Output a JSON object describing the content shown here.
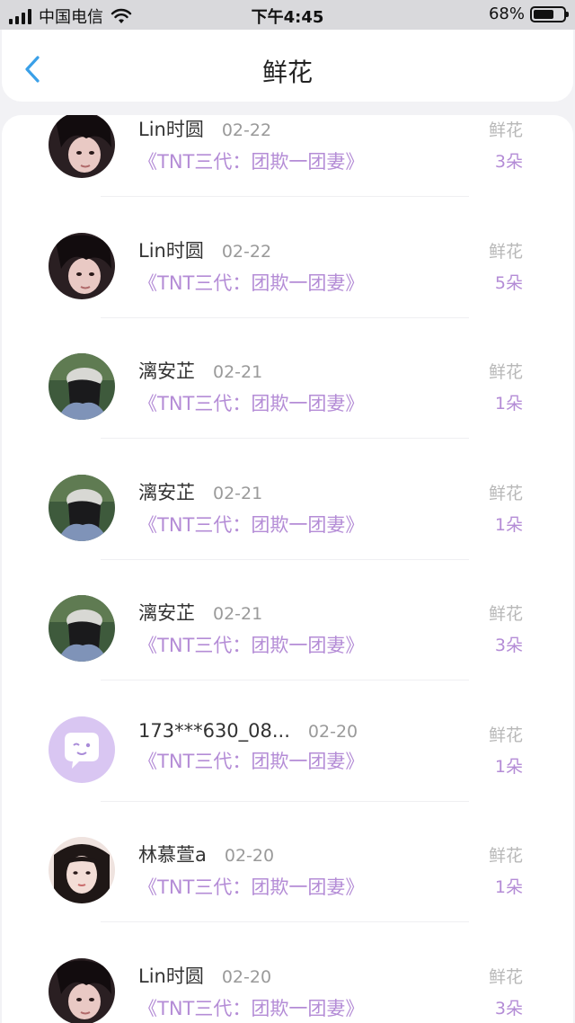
{
  "status_bar": {
    "carrier": "中国电信",
    "time": "下午4:45",
    "battery": "68%",
    "battery_level": 0.68
  },
  "nav": {
    "title": "鲜花",
    "back_icon": "chevron-left-icon",
    "accent": "#3aa0e8"
  },
  "colors": {
    "book_title": "#b48cd6",
    "gift_label": "#b8b8b8"
  },
  "records": [
    {
      "name": "Lin时圆",
      "date": "02-22",
      "book": "《TNT三代：团欺一团妻》",
      "gift": "鲜花",
      "count": "3朵",
      "avatar": "avatar-dark-hair"
    },
    {
      "name": "Lin时圆",
      "date": "02-22",
      "book": "《TNT三代：团欺一团妻》",
      "gift": "鲜花",
      "count": "5朵",
      "avatar": "avatar-dark-hair"
    },
    {
      "name": "漓安芷",
      "date": "02-21",
      "book": "《TNT三代：团欺一团妻》",
      "gift": "鲜花",
      "count": "1朵",
      "avatar": "avatar-cap"
    },
    {
      "name": "漓安芷",
      "date": "02-21",
      "book": "《TNT三代：团欺一团妻》",
      "gift": "鲜花",
      "count": "1朵",
      "avatar": "avatar-cap"
    },
    {
      "name": "漓安芷",
      "date": "02-21",
      "book": "《TNT三代：团欺一团妻》",
      "gift": "鲜花",
      "count": "3朵",
      "avatar": "avatar-cap"
    },
    {
      "name": "173***630_08...",
      "date": "02-20",
      "book": "《TNT三代：团欺一团妻》",
      "gift": "鲜花",
      "count": "1朵",
      "avatar": "avatar-default-chat"
    },
    {
      "name": "林慕萱a",
      "date": "02-20",
      "book": "《TNT三代：团欺一团妻》",
      "gift": "鲜花",
      "count": "1朵",
      "avatar": "avatar-girl"
    },
    {
      "name": "Lin时圆",
      "date": "02-20",
      "book": "《TNT三代：团欺一团妻》",
      "gift": "鲜花",
      "count": "3朵",
      "avatar": "avatar-dark-hair"
    }
  ]
}
